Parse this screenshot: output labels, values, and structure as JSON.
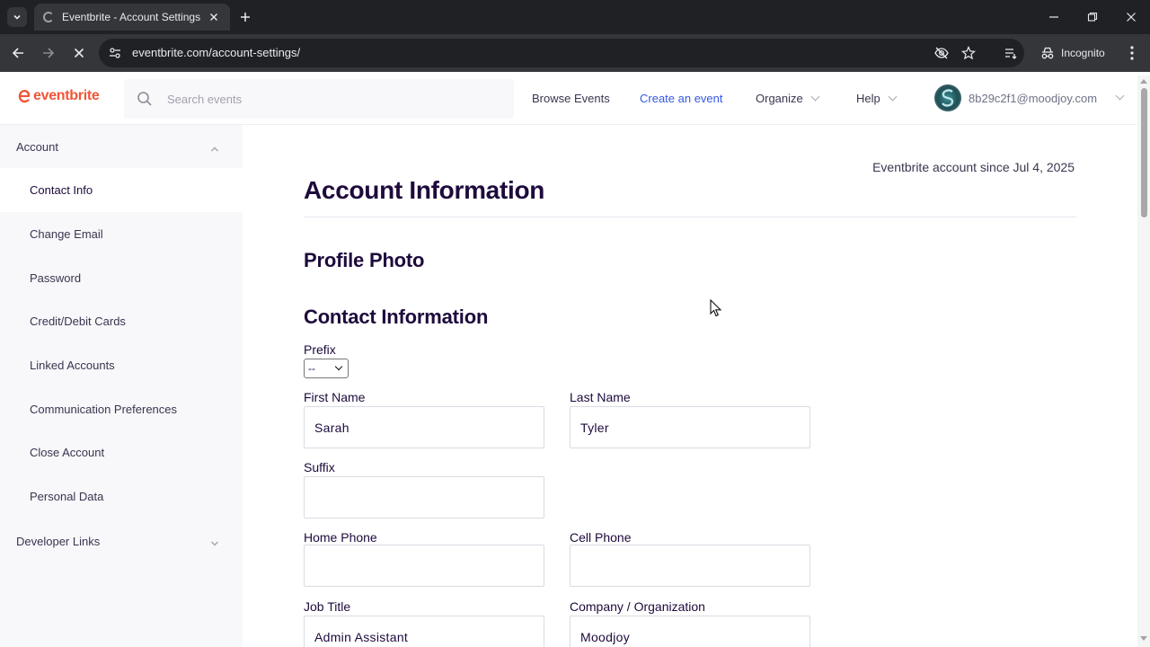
{
  "browser": {
    "tab_title": "Eventbrite - Account Settings",
    "url": "eventbrite.com/account-settings/",
    "incognito_label": "Incognito"
  },
  "header": {
    "logo_text": "eventbrite",
    "search_placeholder": "Search events",
    "nav": {
      "browse": "Browse Events",
      "create": "Create an event",
      "organize": "Organize",
      "help": "Help"
    },
    "user_email": "8b29c2f1@moodjoy.com",
    "accent_color": "#3659e3",
    "brand_color": "#f05537"
  },
  "sidebar": {
    "account_label": "Account",
    "items": [
      {
        "label": "Contact Info"
      },
      {
        "label": "Change Email"
      },
      {
        "label": "Password"
      },
      {
        "label": "Credit/Debit Cards"
      },
      {
        "label": "Linked Accounts"
      },
      {
        "label": "Communication Preferences"
      },
      {
        "label": "Close Account"
      },
      {
        "label": "Personal Data"
      }
    ],
    "developer_label": "Developer Links"
  },
  "main": {
    "since": "Eventbrite account since Jul 4, 2025",
    "title": "Account Information",
    "profile_photo_heading": "Profile Photo",
    "contact_heading": "Contact Information",
    "fields": {
      "prefix": {
        "label": "Prefix",
        "value": "--"
      },
      "first_name": {
        "label": "First Name",
        "value": "Sarah"
      },
      "last_name": {
        "label": "Last Name",
        "value": "Tyler"
      },
      "suffix": {
        "label": "Suffix",
        "value": ""
      },
      "home_phone": {
        "label": "Home Phone",
        "value": ""
      },
      "cell_phone": {
        "label": "Cell Phone",
        "value": ""
      },
      "job_title": {
        "label": "Job Title",
        "value": "Admin Assistant"
      },
      "company": {
        "label": "Company / Organization",
        "value": "Moodjoy"
      }
    }
  }
}
